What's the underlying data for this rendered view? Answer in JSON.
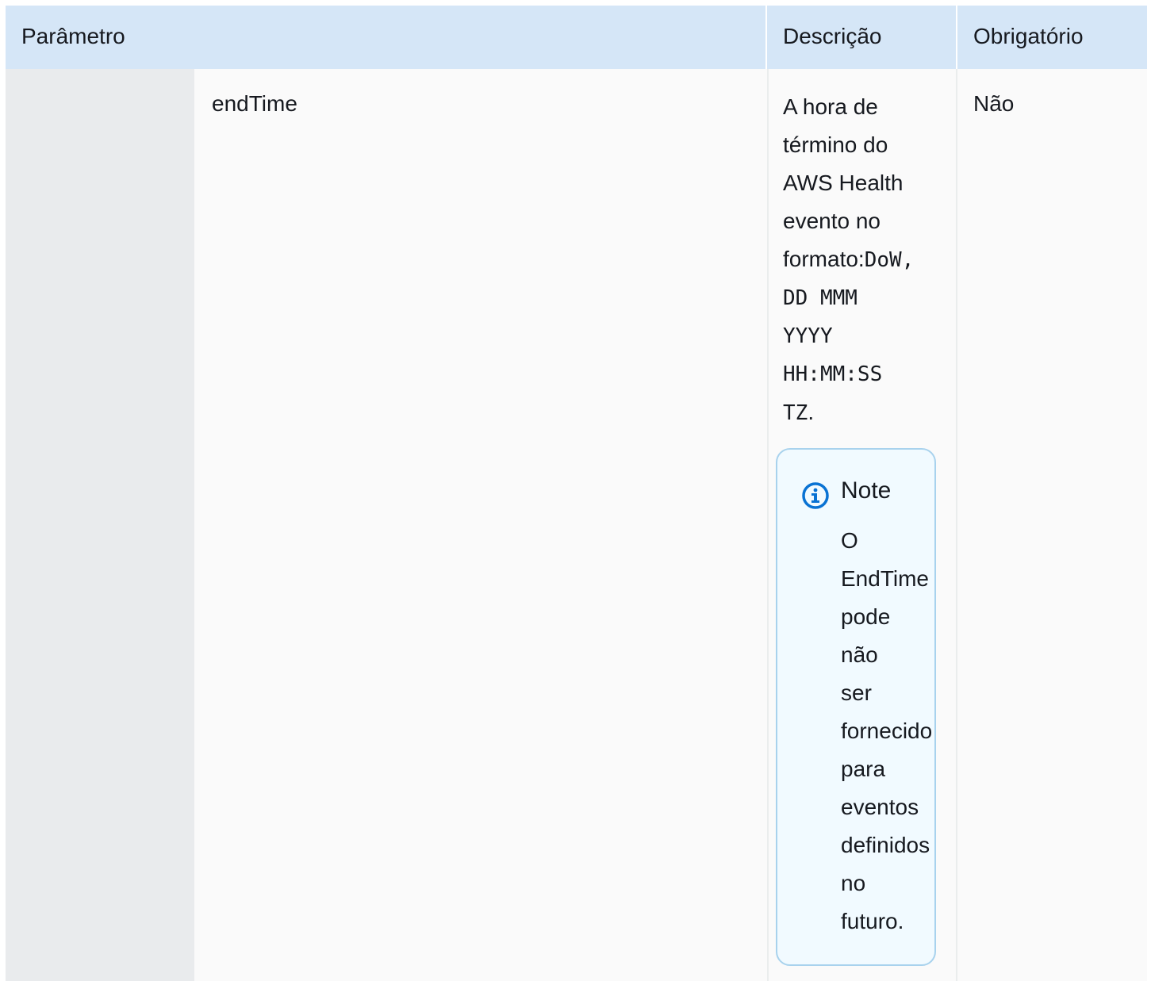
{
  "table": {
    "headers": {
      "parameter": "Parâmetro",
      "description": "Descrição",
      "required": "Obrigatório"
    },
    "row": {
      "parameter_name": "endTime",
      "description_lines": [
        {
          "text": "A hora de",
          "mono": false
        },
        {
          "text": "término do",
          "mono": false
        },
        {
          "text": "AWS Health",
          "mono": false
        },
        {
          "text": "evento no",
          "mono": false
        },
        {
          "text_prefix": "formato:",
          "text_mono": "DoW,"
        },
        {
          "text": "DD MMM",
          "mono": true
        },
        {
          "text": "YYYY",
          "mono": true
        },
        {
          "text": "HH:MM:SS",
          "mono": true
        },
        {
          "text_mono": "TZ",
          "text_suffix": "."
        }
      ],
      "required_value": "Não",
      "note": {
        "icon": "info-icon",
        "title": "Note",
        "body_lines": [
          "O",
          "EndTime",
          "pode",
          "não",
          "ser",
          "fornecido",
          "para",
          "eventos",
          "definidos",
          "no",
          "futuro."
        ]
      }
    }
  },
  "colors": {
    "header_bg": "#d5e6f7",
    "indent_bg": "#e9ebed",
    "row_bg": "#fafafa",
    "note_border": "#a8d2ed",
    "note_bg": "#f1faff",
    "info_icon": "#0972d3"
  }
}
